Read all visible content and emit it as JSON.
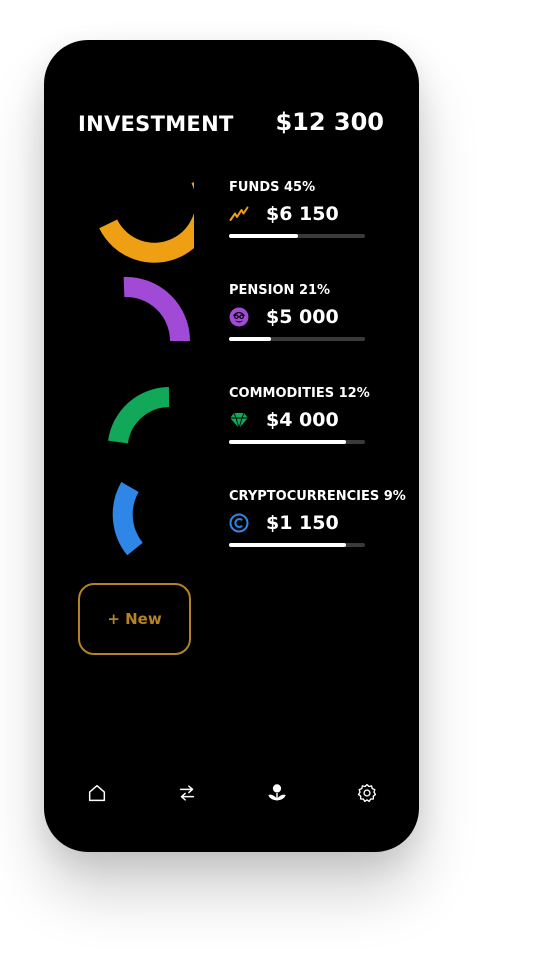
{
  "header": {
    "title": "INVESTMENT",
    "total": "$12 300"
  },
  "items": [
    {
      "label": "FUNDS 45%",
      "amount": "$6 150",
      "icon": "trend-icon",
      "color": "#ee9f13",
      "progress": 0.51
    },
    {
      "label": "PENSION 21%",
      "amount": "$5 000",
      "icon": "grandpa-icon",
      "color": "#a04ad6",
      "progress": 0.31
    },
    {
      "label": "COMMODITIES 12%",
      "amount": "$4 000",
      "icon": "diamond-icon",
      "color": "#11a85a",
      "progress": 0.86
    },
    {
      "label": "CRYPTOCURRENCIES 9%",
      "amount": "$1 150",
      "icon": "crypto-coin-icon",
      "color": "#2e86e6",
      "progress": 0.86
    }
  ],
  "new_button": {
    "label": "+ New",
    "color": "#b58321"
  },
  "nav": [
    {
      "name": "home-icon"
    },
    {
      "name": "transfer-icon"
    },
    {
      "name": "plant-icon"
    },
    {
      "name": "settings-icon"
    }
  ]
}
